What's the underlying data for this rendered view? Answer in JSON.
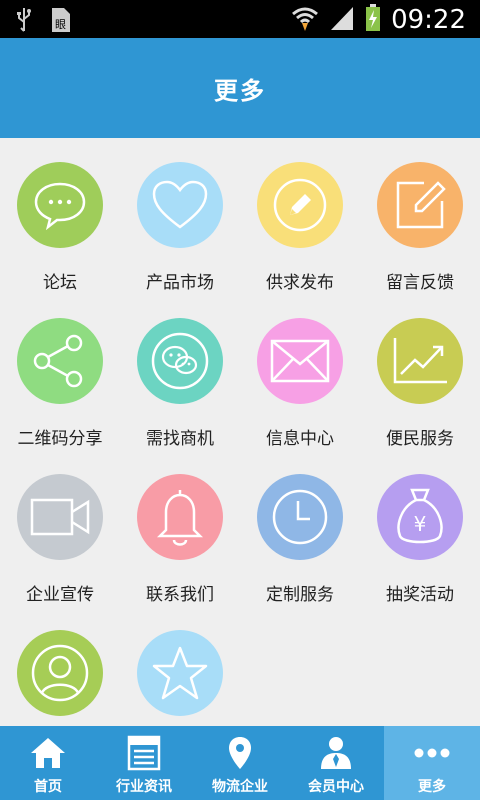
{
  "status_bar": {
    "time": "09:22"
  },
  "header": {
    "title": "更多"
  },
  "grid": [
    {
      "name": "forum",
      "label": "论坛",
      "color": "#9fcd5a",
      "icon": "chat-bubble-icon"
    },
    {
      "name": "product-market",
      "label": "产品市场",
      "color": "#a8ddf8",
      "icon": "heart-icon"
    },
    {
      "name": "supply-demand",
      "label": "供求发布",
      "color": "#f9df79",
      "icon": "pencil-icon"
    },
    {
      "name": "feedback",
      "label": "留言反馈",
      "color": "#f8b36a",
      "icon": "edit-icon"
    },
    {
      "name": "share",
      "label": "二维码分享",
      "color": "#8fdc81",
      "icon": "share-icon"
    },
    {
      "name": "find-business",
      "label": "需找商机",
      "color": "#6cd4c2",
      "icon": "wechat-icon"
    },
    {
      "name": "messages",
      "label": "信息中心",
      "color": "#f7a0e5",
      "icon": "envelope-icon"
    },
    {
      "name": "services",
      "label": "便民服务",
      "color": "#c8cc53",
      "icon": "trend-chart-icon"
    },
    {
      "name": "promo",
      "label": "企业宣传",
      "color": "#c5cad0",
      "icon": "video-camera-icon"
    },
    {
      "name": "contact",
      "label": "联系我们",
      "color": "#f89ca6",
      "icon": "bell-icon"
    },
    {
      "name": "custom-service",
      "label": "定制服务",
      "color": "#8fb7e6",
      "icon": "clock-icon"
    },
    {
      "name": "lottery",
      "label": "抽奖活动",
      "color": "#b69ef0",
      "icon": "money-bag-icon"
    },
    {
      "name": "member",
      "label": "",
      "color": "#a6cd56",
      "icon": "user-circle-icon"
    },
    {
      "name": "favorites",
      "label": "",
      "color": "#a8ddf8",
      "icon": "star-icon"
    }
  ],
  "bottom_nav": [
    {
      "label": "首页",
      "icon": "home-icon"
    },
    {
      "label": "行业资讯",
      "icon": "newspaper-icon"
    },
    {
      "label": "物流企业",
      "icon": "location-pin-icon"
    },
    {
      "label": "会员中心",
      "icon": "member-icon"
    },
    {
      "label": "更多",
      "icon": "more-dots-icon"
    }
  ]
}
